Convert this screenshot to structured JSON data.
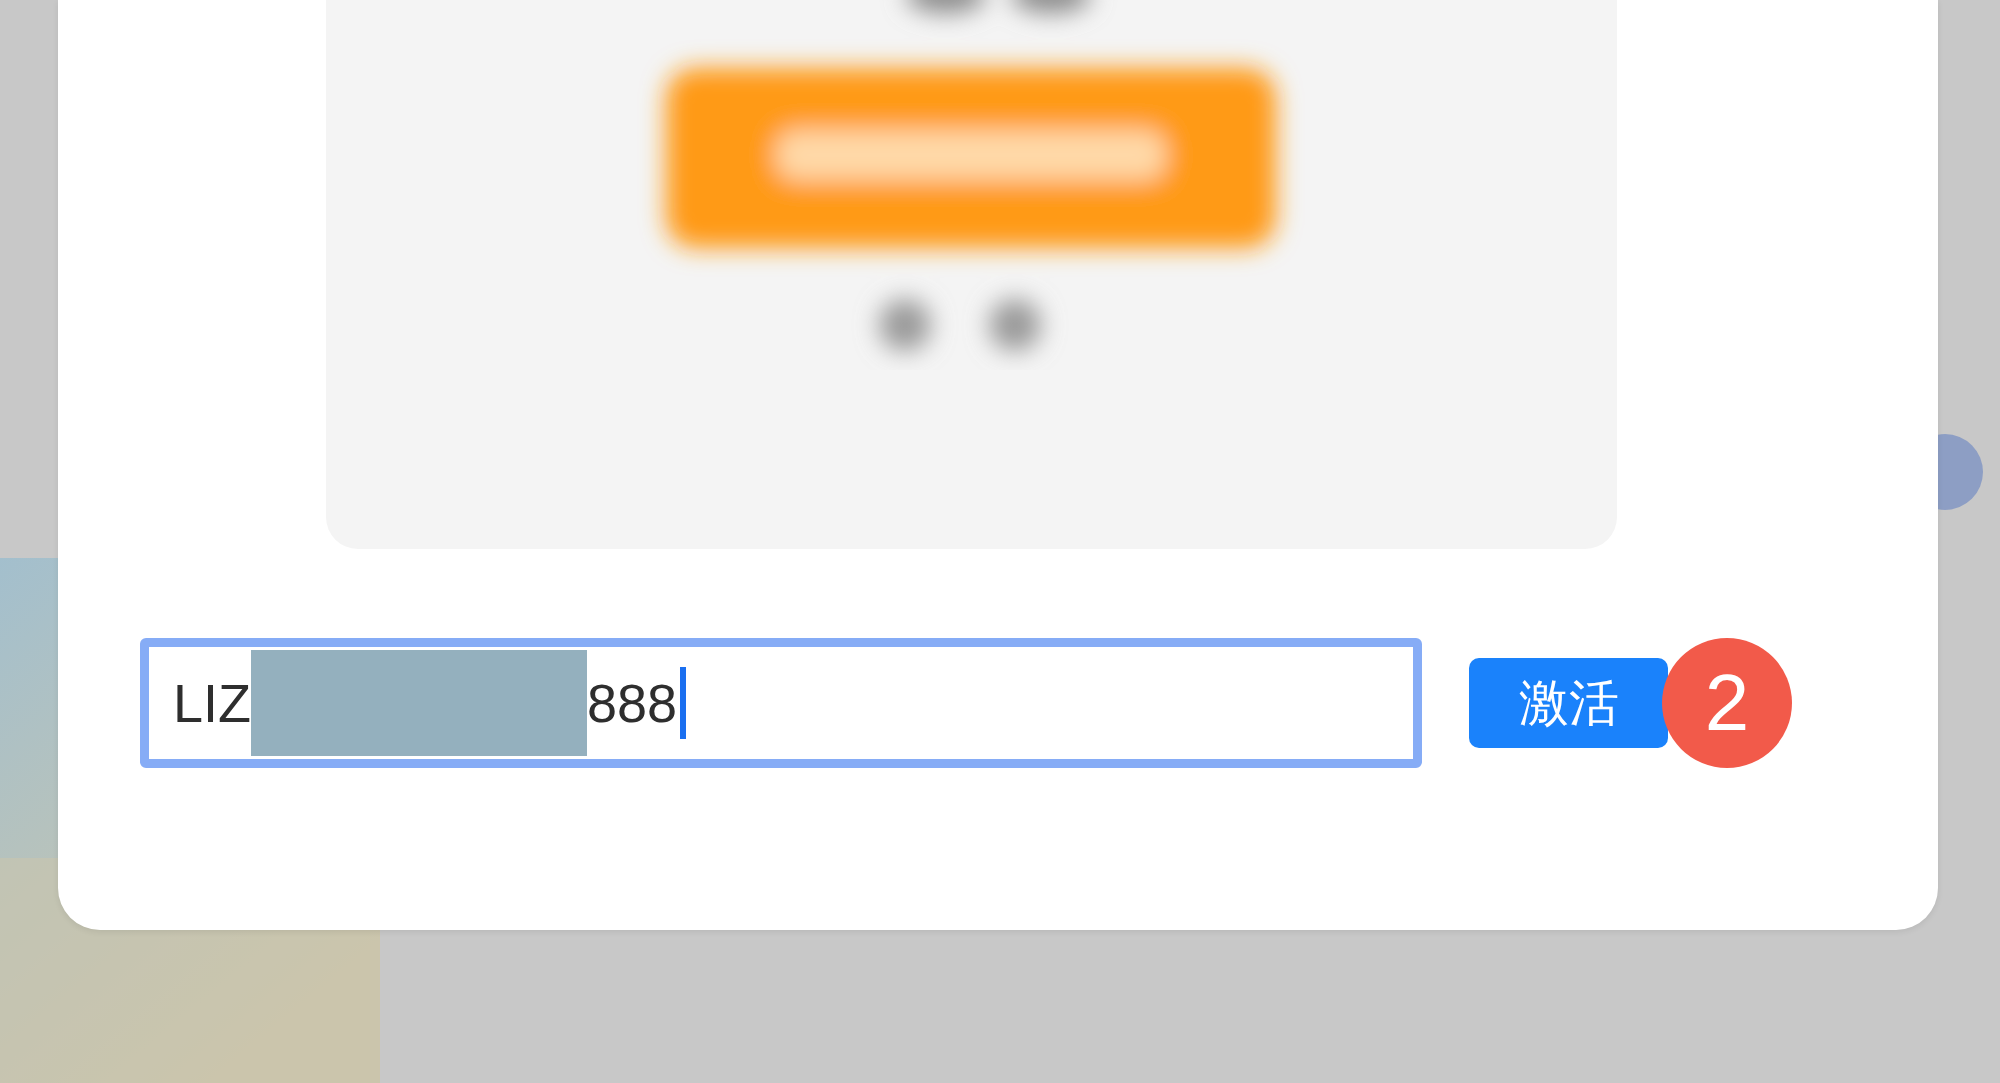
{
  "activation_field": {
    "value_start": "LIZ",
    "value_end": "888",
    "redacted": true,
    "focused": true
  },
  "activate_button": {
    "label": "激活"
  },
  "step_badge": {
    "label": "2"
  }
}
